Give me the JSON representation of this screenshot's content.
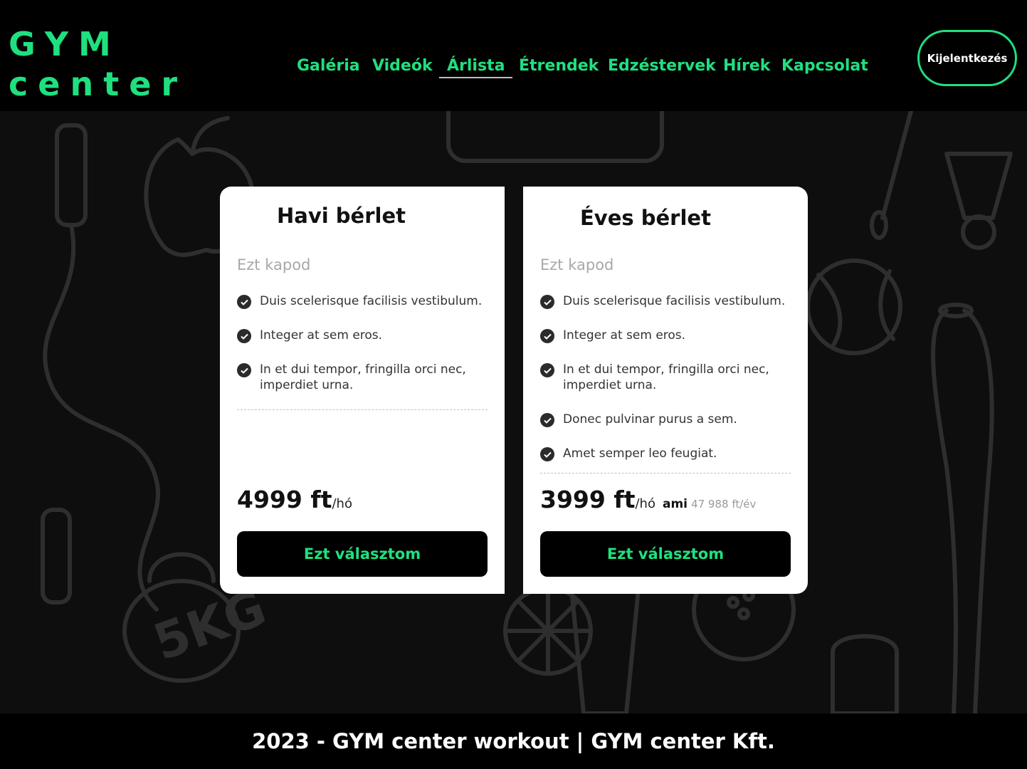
{
  "brand": {
    "line1": "GYM",
    "line2": "center"
  },
  "nav": {
    "items": [
      {
        "label": "Galéria"
      },
      {
        "label": "Videók"
      },
      {
        "label": "Árlista",
        "active": true
      },
      {
        "label": "Étrendek"
      },
      {
        "label": "Edzéstervek"
      },
      {
        "label": "Hírek"
      },
      {
        "label": "Kapcsolat"
      }
    ]
  },
  "header": {
    "logout_label": "Kijelentkezés"
  },
  "plans": [
    {
      "title": "Havi bérlet",
      "subtitle": "Ezt kapod",
      "features": [
        "Duis scelerisque facilisis vestibulum.",
        "Integer at sem eros.",
        "In et dui tempor, fringilla orci nec, imperdiet urna."
      ],
      "price": "4999 ft",
      "price_unit": "/hó",
      "button_label": "Ezt választom"
    },
    {
      "title": "Éves bérlet",
      "subtitle": "Ezt kapod",
      "features": [
        "Duis scelerisque facilisis vestibulum.",
        "Integer at sem eros.",
        "In et dui tempor, fringilla orci nec, imperdiet urna.",
        "Donec pulvinar purus a sem.",
        "Amet semper leo feugiat."
      ],
      "price": "3999 ft",
      "price_unit": "/hó",
      "price_note_label": "ami",
      "price_note_value": "47 988 ft/év",
      "button_label": "Ezt választom"
    }
  ],
  "footer": {
    "text": "2023 - GYM center workout | GYM center Kft."
  },
  "colors": {
    "accent": "#1fe07f",
    "background": "#0e0e0e",
    "card": "#ffffff"
  },
  "background_icons": [
    "apple-icon",
    "kettlebell-icon",
    "shuttlecock-icon",
    "bat-icon",
    "baseball-icon",
    "jump-rope-icon",
    "lemon-icon"
  ]
}
